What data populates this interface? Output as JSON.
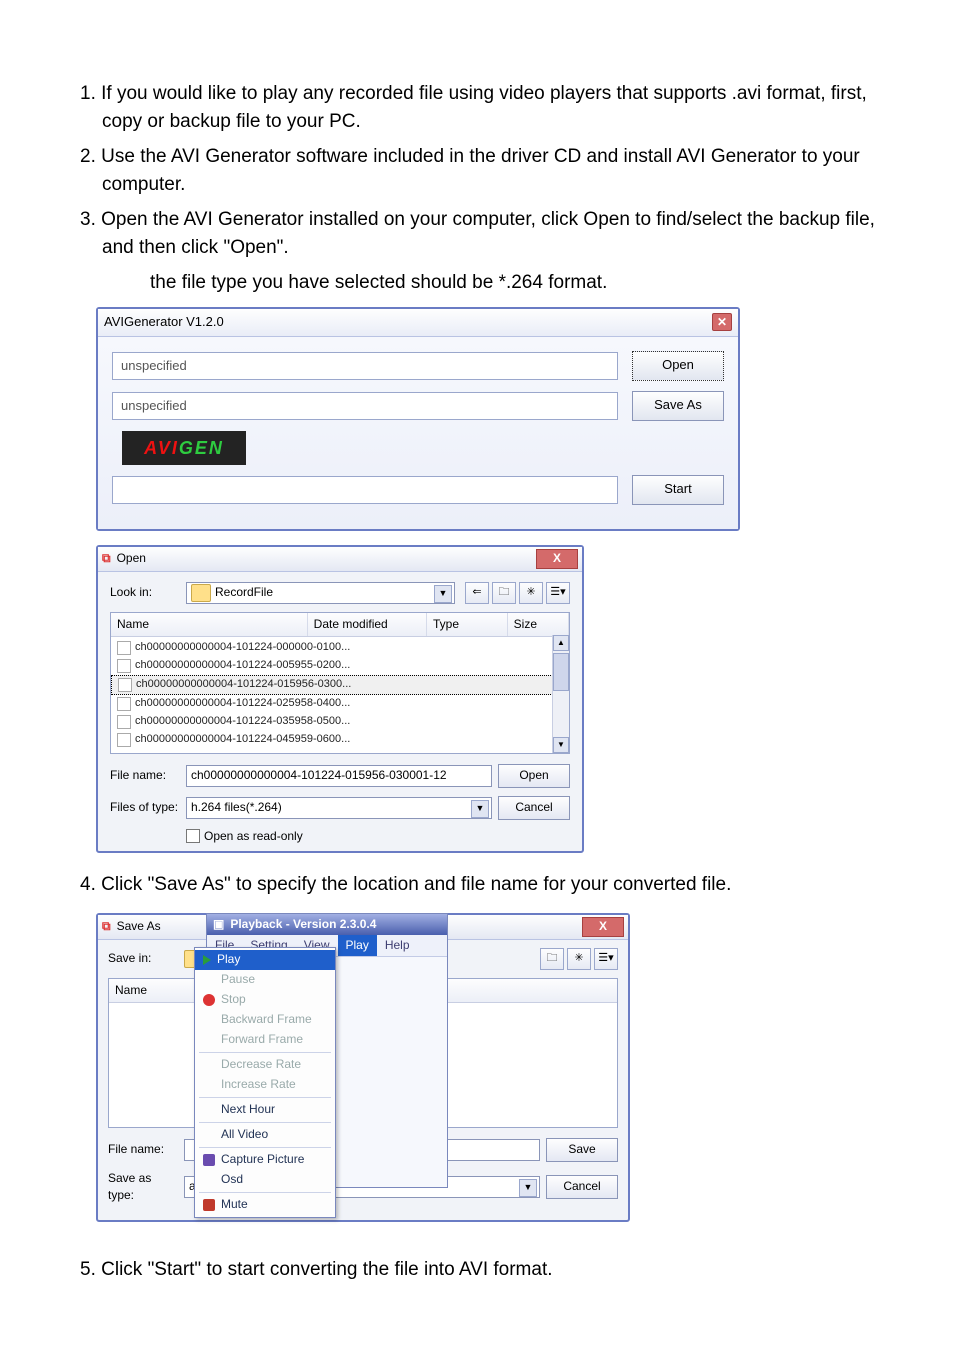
{
  "instructions": {
    "item1": "1. If you would like to play any recorded file using video players that supports .avi format, first, copy or backup file to your PC.",
    "item2": "2. Use the AVI Generator software included in the driver CD and install AVI Generator to your computer.",
    "item3": "3. Open the AVI Generator installed on your computer, click Open to find/select the backup file, and then click \"Open\".",
    "item3_sub": "the file type you have selected should be *.264 format.",
    "item4": "4. Click \"Save As\" to specify the location and file name for your converted file.",
    "item5": "5. Click \"Start\" to start converting the file into AVI format."
  },
  "app1": {
    "title": "AVIGenerator V1.2.0",
    "field1": "unspecified",
    "field2": "unspecified",
    "open_btn": "Open",
    "saveas_btn": "Save As",
    "start_btn": "Start",
    "logo_left": "AVI",
    "logo_right": " GEN"
  },
  "open_dialog": {
    "title": "Open",
    "look_in_label": "Look in:",
    "look_in_value": "RecordFile",
    "headers": {
      "name": "Name",
      "date": "Date modified",
      "type": "Type",
      "size": "Size"
    },
    "files": [
      "ch00000000000004-101224-000000-0100...",
      "ch00000000000004-101224-005955-0200...",
      "ch00000000000004-101224-015956-0300...",
      "ch00000000000004-101224-025958-0400...",
      "ch00000000000004-101224-035958-0500...",
      "ch00000000000004-101224-045959-0600..."
    ],
    "selected_index": 2,
    "file_name_label": "File name:",
    "file_name_value": "ch00000000000004-101224-015956-030001-12",
    "file_type_label": "Files of type:",
    "file_type_value": "h.264 files(*.264)",
    "readonly_label": "Open as read-only",
    "open_btn": "Open",
    "cancel_btn": "Cancel"
  },
  "saveas_dialog": {
    "title": "Save As",
    "save_in_label": "Save in:",
    "name_header": "Name",
    "file_name_label": "File name:",
    "file_type_label": "Save as type:",
    "file_type_value": "avi files(*.avi)",
    "save_btn": "Save",
    "cancel_btn": "Cancel"
  },
  "playback_menu": {
    "title": "Playback - Version 2.3.0.4",
    "menus": [
      "File",
      "Setting",
      "View",
      "Play",
      "Help"
    ],
    "active_menu_index": 3,
    "dropdown": [
      {
        "label": "Play",
        "active": true,
        "icon": "play"
      },
      {
        "label": "Pause",
        "disabled": true
      },
      {
        "label": "Stop",
        "disabled": true,
        "icon": "red"
      },
      {
        "label": "Backward Frame",
        "disabled": true
      },
      {
        "label": "Forward  Frame",
        "disabled": true,
        "sep_after": true
      },
      {
        "label": "Decrease Rate",
        "disabled": true
      },
      {
        "label": "Increase Rate",
        "disabled": true,
        "sep_after": true
      },
      {
        "label": "Next Hour",
        "sep_after": true
      },
      {
        "label": "All Video",
        "sep_after": true
      },
      {
        "label": "Capture Picture",
        "icon": "cam"
      },
      {
        "label": "Osd",
        "sep_after": true
      },
      {
        "label": "Mute",
        "icon": "spk"
      }
    ]
  }
}
